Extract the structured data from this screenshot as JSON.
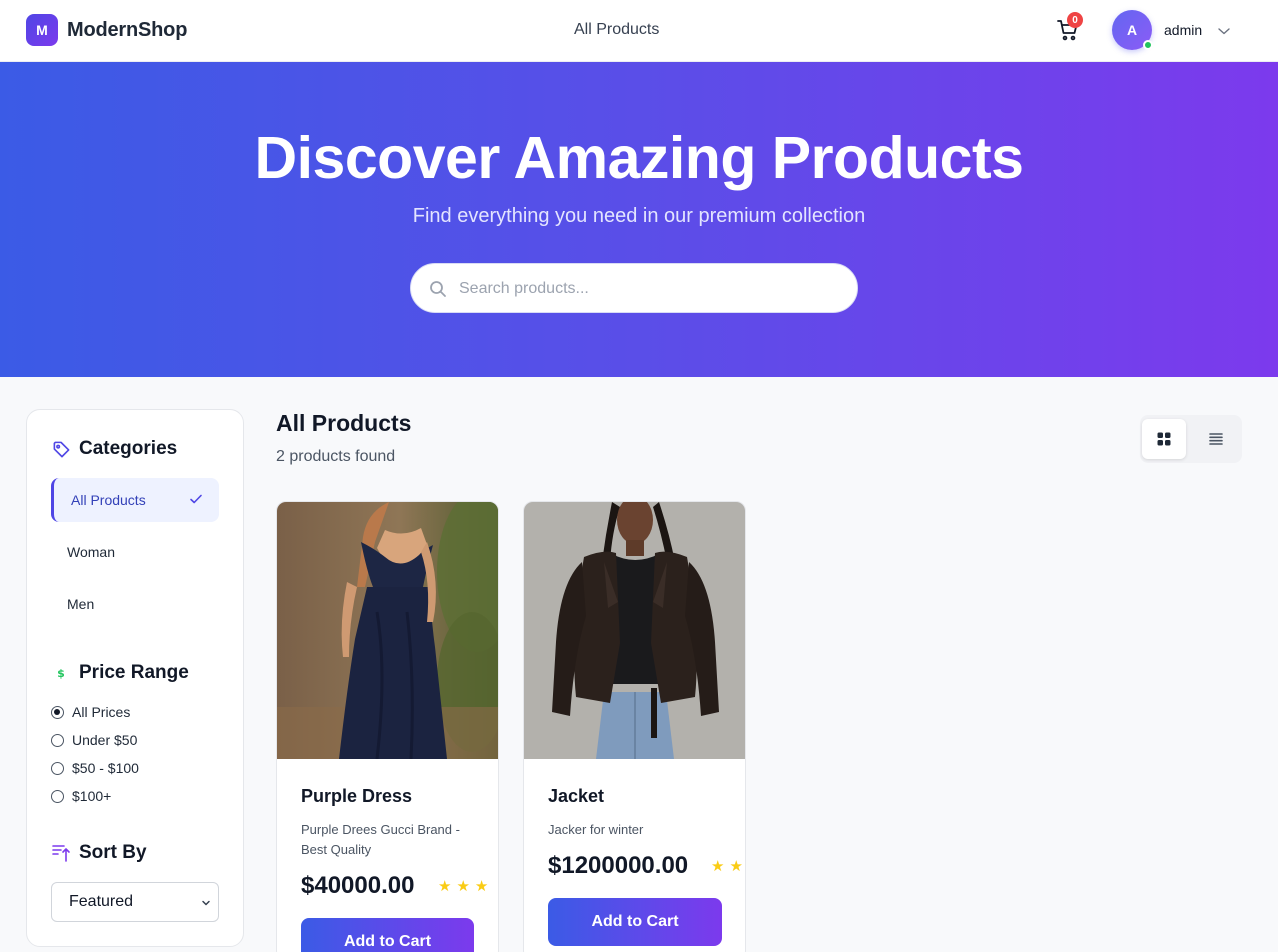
{
  "header": {
    "logo_letter": "M",
    "brand": "ModernShop",
    "nav_link": "All Products",
    "cart_count": "0",
    "avatar_initial": "A",
    "username": "admin"
  },
  "hero": {
    "title": "Discover Amazing Products",
    "subtitle": "Find everything you need in our premium collection",
    "search_placeholder": "Search products..."
  },
  "sidebar": {
    "categories_title": "Categories",
    "categories": [
      {
        "label": "All Products",
        "active": true
      },
      {
        "label": "Woman",
        "active": false
      },
      {
        "label": "Men",
        "active": false
      }
    ],
    "price_title": "Price Range",
    "price_options": [
      {
        "label": "All Prices",
        "selected": true
      },
      {
        "label": "Under $50",
        "selected": false
      },
      {
        "label": "$50 - $100",
        "selected": false
      },
      {
        "label": "$100+",
        "selected": false
      }
    ],
    "sort_title": "Sort By",
    "sort_value": "Featured"
  },
  "main": {
    "title": "All Products",
    "count": "2 products found",
    "view_mode": "grid"
  },
  "products": [
    {
      "name": "Purple Dress",
      "description": "Purple Drees Gucci Brand - Best Quality",
      "price": "$40000.00",
      "rating": 3,
      "button": "Add to Cart"
    },
    {
      "name": "Jacket",
      "description": "Jacker for winter",
      "price": "$1200000.00",
      "rating": 2,
      "button": "Add to Cart"
    }
  ],
  "colors": {
    "accent": "#4f46e5",
    "gradient_start": "#3b5be6",
    "gradient_end": "#7c3aed",
    "star": "#facc15",
    "badge": "#ef4444",
    "online": "#22c55e"
  },
  "icons": {
    "cart": "shopping-cart-icon",
    "search": "search-icon",
    "categories": "tag-icon",
    "price": "dollar-icon",
    "sort": "sort-icon",
    "grid": "grid-icon",
    "list": "list-icon"
  }
}
